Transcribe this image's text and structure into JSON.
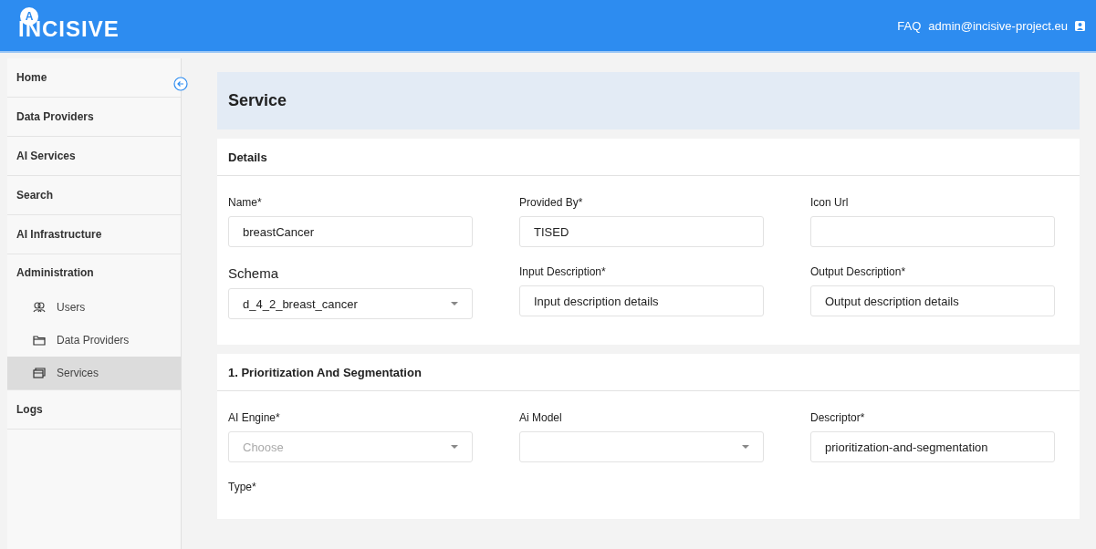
{
  "header": {
    "logo": "INCISIVE",
    "logo_mark": "A",
    "links": [
      "FAQ",
      "admin@incisive-project.eu"
    ]
  },
  "sidebar": {
    "items": [
      {
        "label": "Home",
        "kind": "section",
        "selected": false
      },
      {
        "label": "Data Providers",
        "kind": "section",
        "selected": false
      },
      {
        "label": "AI Services",
        "kind": "section",
        "selected": false
      },
      {
        "label": "Search",
        "kind": "section",
        "selected": false
      },
      {
        "label": "AI Infrastructure",
        "kind": "section",
        "selected": false
      },
      {
        "label": "Administration",
        "kind": "group",
        "selected": false,
        "children": [
          {
            "label": "Users",
            "selected": false
          },
          {
            "label": "Data Providers",
            "selected": false
          },
          {
            "label": "Services",
            "selected": true
          }
        ]
      },
      {
        "label": "Logs",
        "kind": "section",
        "selected": false
      }
    ]
  },
  "page": {
    "title": "Service",
    "sections": [
      {
        "title": "Details",
        "fields": [
          {
            "label": "Name*",
            "kind": "text",
            "value": "breastCancer"
          },
          {
            "label": "Provided By*",
            "kind": "text",
            "value": "TISED"
          },
          {
            "label": "Icon Url",
            "kind": "text"
          },
          {
            "label": "Schema",
            "kind": "select",
            "value": "d_4_2_breast_cancer",
            "emphasized": true
          },
          {
            "label": "Input Description*",
            "kind": "text",
            "value": "Input description details"
          },
          {
            "label": "Output Description*",
            "kind": "text",
            "value": "Output description details"
          }
        ]
      },
      {
        "title": "1. Prioritization And Segmentation",
        "fields": [
          {
            "label": "AI Engine*",
            "kind": "select",
            "placeholder": "Choose"
          },
          {
            "label": "Ai Model",
            "kind": "select"
          },
          {
            "label": "Descriptor*",
            "kind": "text",
            "value": "prioritization-and-segmentation"
          },
          {
            "label": "Type*",
            "kind": "label"
          }
        ]
      }
    ]
  }
}
